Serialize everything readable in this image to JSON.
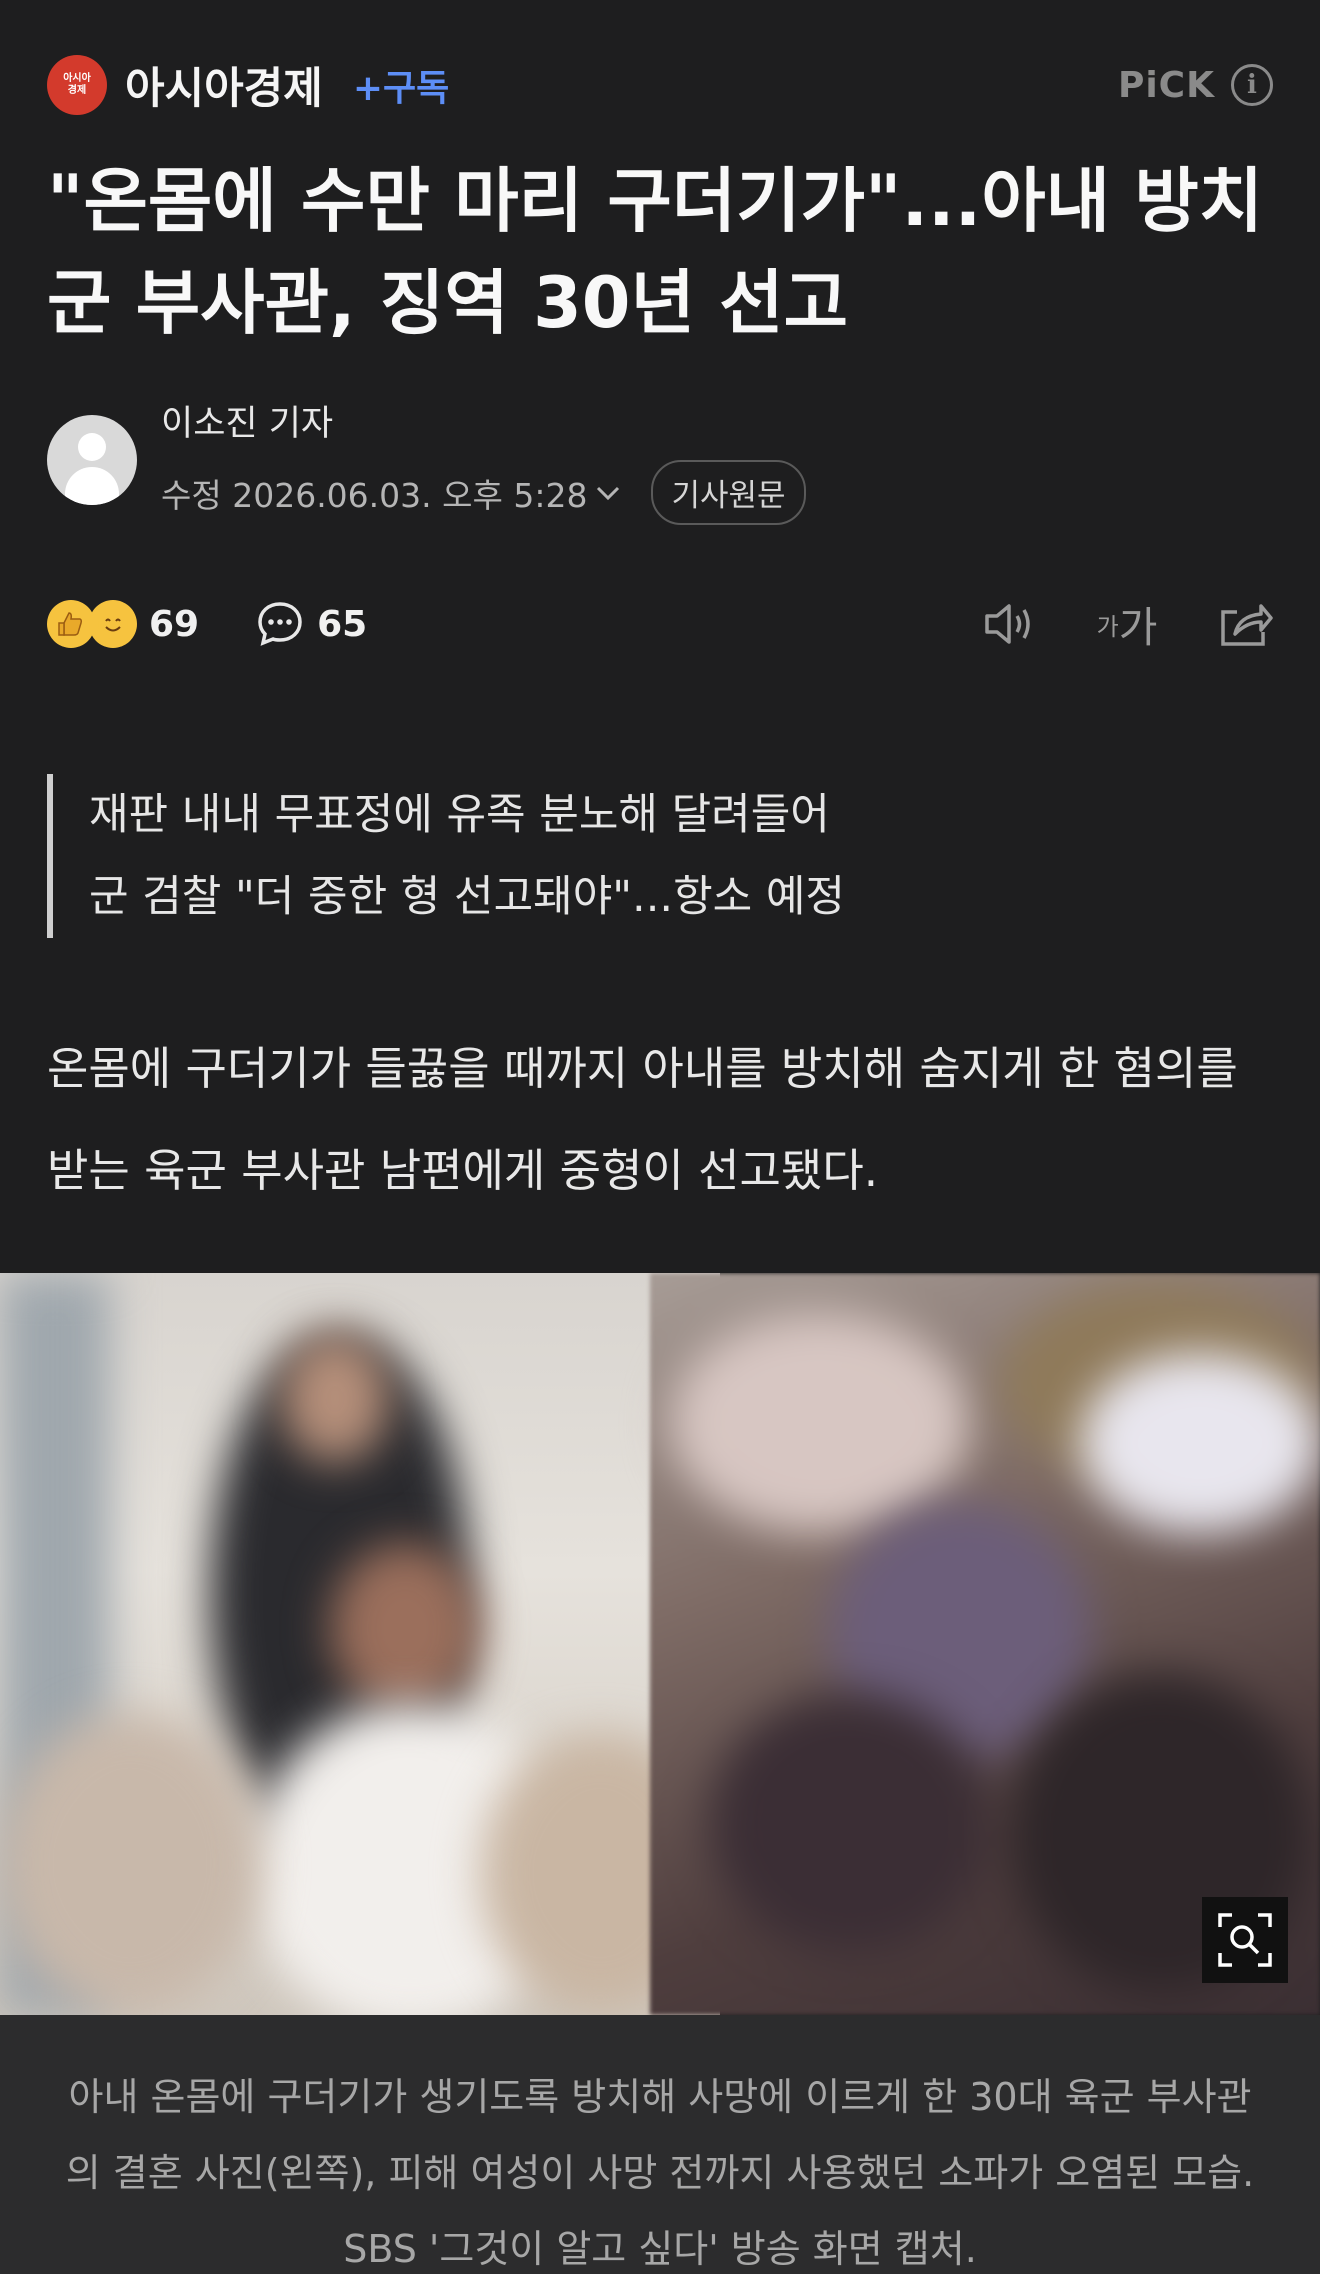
{
  "press": {
    "logo_text_top": "아시아",
    "logo_text_bottom": "경제",
    "name": "아시아경제",
    "subscribe_label": "+구독",
    "pick_label": "PiCK",
    "info_glyph": "i"
  },
  "article": {
    "headline": "\"온몸에 수만 마리 구더기가\"...아내 방치 군 부사관, 징역 30년 선고",
    "reporter": "이소진 기자",
    "timestamp": "수정 2026.06.03. 오후 5:28",
    "original_button": "기사원문",
    "reactions_count": "69",
    "comments_count": "65",
    "font_size_small": "가",
    "font_size_large": "가",
    "summary": [
      "재판 내내 무표정에 유족 분노해 달려들어",
      "군 검찰 \"더 중한 형 선고돼야\"...항소 예정"
    ],
    "lead": "온몸에 구더기가 들끓을 때까지 아내를 방치해 숨지게 한 혐의를 받는 육군 부사관 남편에게 중형이 선고됐다.",
    "caption": "아내 온몸에 구더기가 생기도록 방치해 사망에 이르게 한 30대 육군 부사관의 결혼 사진(왼쪽), 피해 여성이 사망 전까지 사용했던 소파가 오염된 모습. SBS '그것이 알고 싶다' 방송 화면 캡처."
  },
  "icons": {
    "logo": "press-logo",
    "info": "info-icon",
    "reaction": "emoji-reaction-icon",
    "comment": "comment-icon",
    "speaker": "speaker-icon",
    "font_size": "font-size-icon",
    "share": "share-icon",
    "zoom": "zoom-search-icon"
  },
  "colors": {
    "background": "#1e1e1f",
    "accent_blue": "#5d8ef6",
    "logo_red": "#d33a2c",
    "caption_bg": "#2c2c2d"
  }
}
